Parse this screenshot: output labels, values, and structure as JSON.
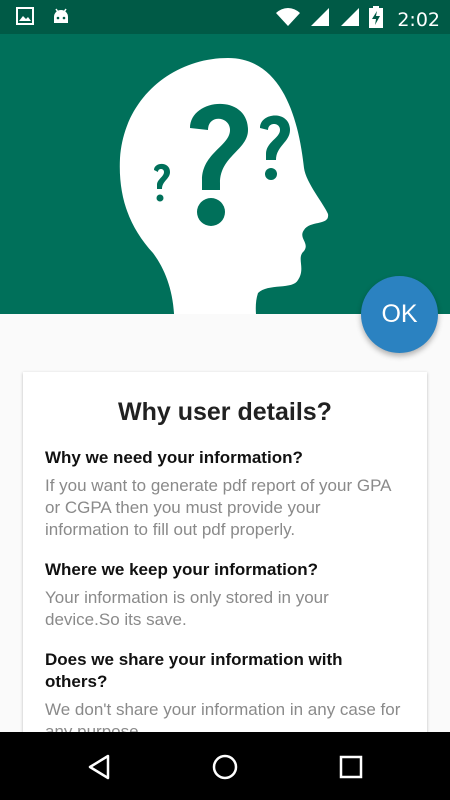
{
  "status_bar": {
    "time": "2:02",
    "icons": [
      "image-icon",
      "android-icon",
      "wifi-icon",
      "signal-icon",
      "signal-icon",
      "battery-charging-icon"
    ]
  },
  "header": {
    "bg_color": "#00705a",
    "illustration": "head-question-marks-icon"
  },
  "fab": {
    "label": "OK",
    "color": "#2b82c1"
  },
  "card": {
    "title": "Why user details?",
    "items": [
      {
        "question": "Why we need your information?",
        "answer": "If you want to generate pdf report of your GPA or CGPA then you must provide your information to fill out pdf properly."
      },
      {
        "question": "Where we keep your information?",
        "answer": "Your information is only stored in your device.So its save."
      },
      {
        "question": "Does we share your information with others?",
        "answer": "We don't share your information in any case for any purpose."
      }
    ]
  },
  "nav_bar": {
    "buttons": [
      "back-icon",
      "home-icon",
      "recents-icon"
    ]
  }
}
